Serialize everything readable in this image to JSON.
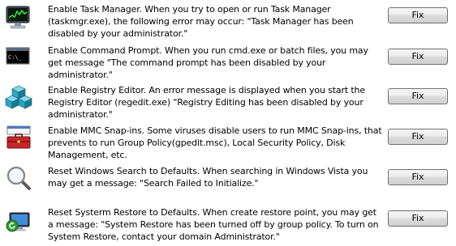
{
  "fix_label": "Fix",
  "items": [
    {
      "icon": "task-manager-icon",
      "text": "Enable Task Manager. When you try to open or run Task Manager (taskmgr.exe), the following error may occur: \"Task Manager has been disabled by your administrator.\""
    },
    {
      "icon": "command-prompt-icon",
      "text": "Enable Command Prompt. When you run cmd.exe or batch files, you may get message \"The command prompt has been disabled by your administrator.\""
    },
    {
      "icon": "registry-editor-icon",
      "text": "Enable Registry Editor. An error message is displayed when you start the Registry Editor (regedit.exe) \"Registry Editing has been disabled by your administrator.\""
    },
    {
      "icon": "mmc-toolbox-icon",
      "text": "Enable MMC Snap-ins. Some viruses disable users to run MMC Snap-ins, that prevents to run Group Policy(gpedit.msc), Local Security Policy, Disk Management, etc."
    },
    {
      "icon": "search-magnifier-icon",
      "text": "Reset Windows Search to Defaults. When searching in Windows Vista you may get a message: \"Search Failed to Initialize.\""
    },
    {
      "icon": "system-restore-icon",
      "text": "Reset Systerm Restore to Defaults. When create restore point, you may get a message: \"System Restore has been turned off by group policy. To turn on System Restore, contact your domain Administrator.\""
    }
  ]
}
